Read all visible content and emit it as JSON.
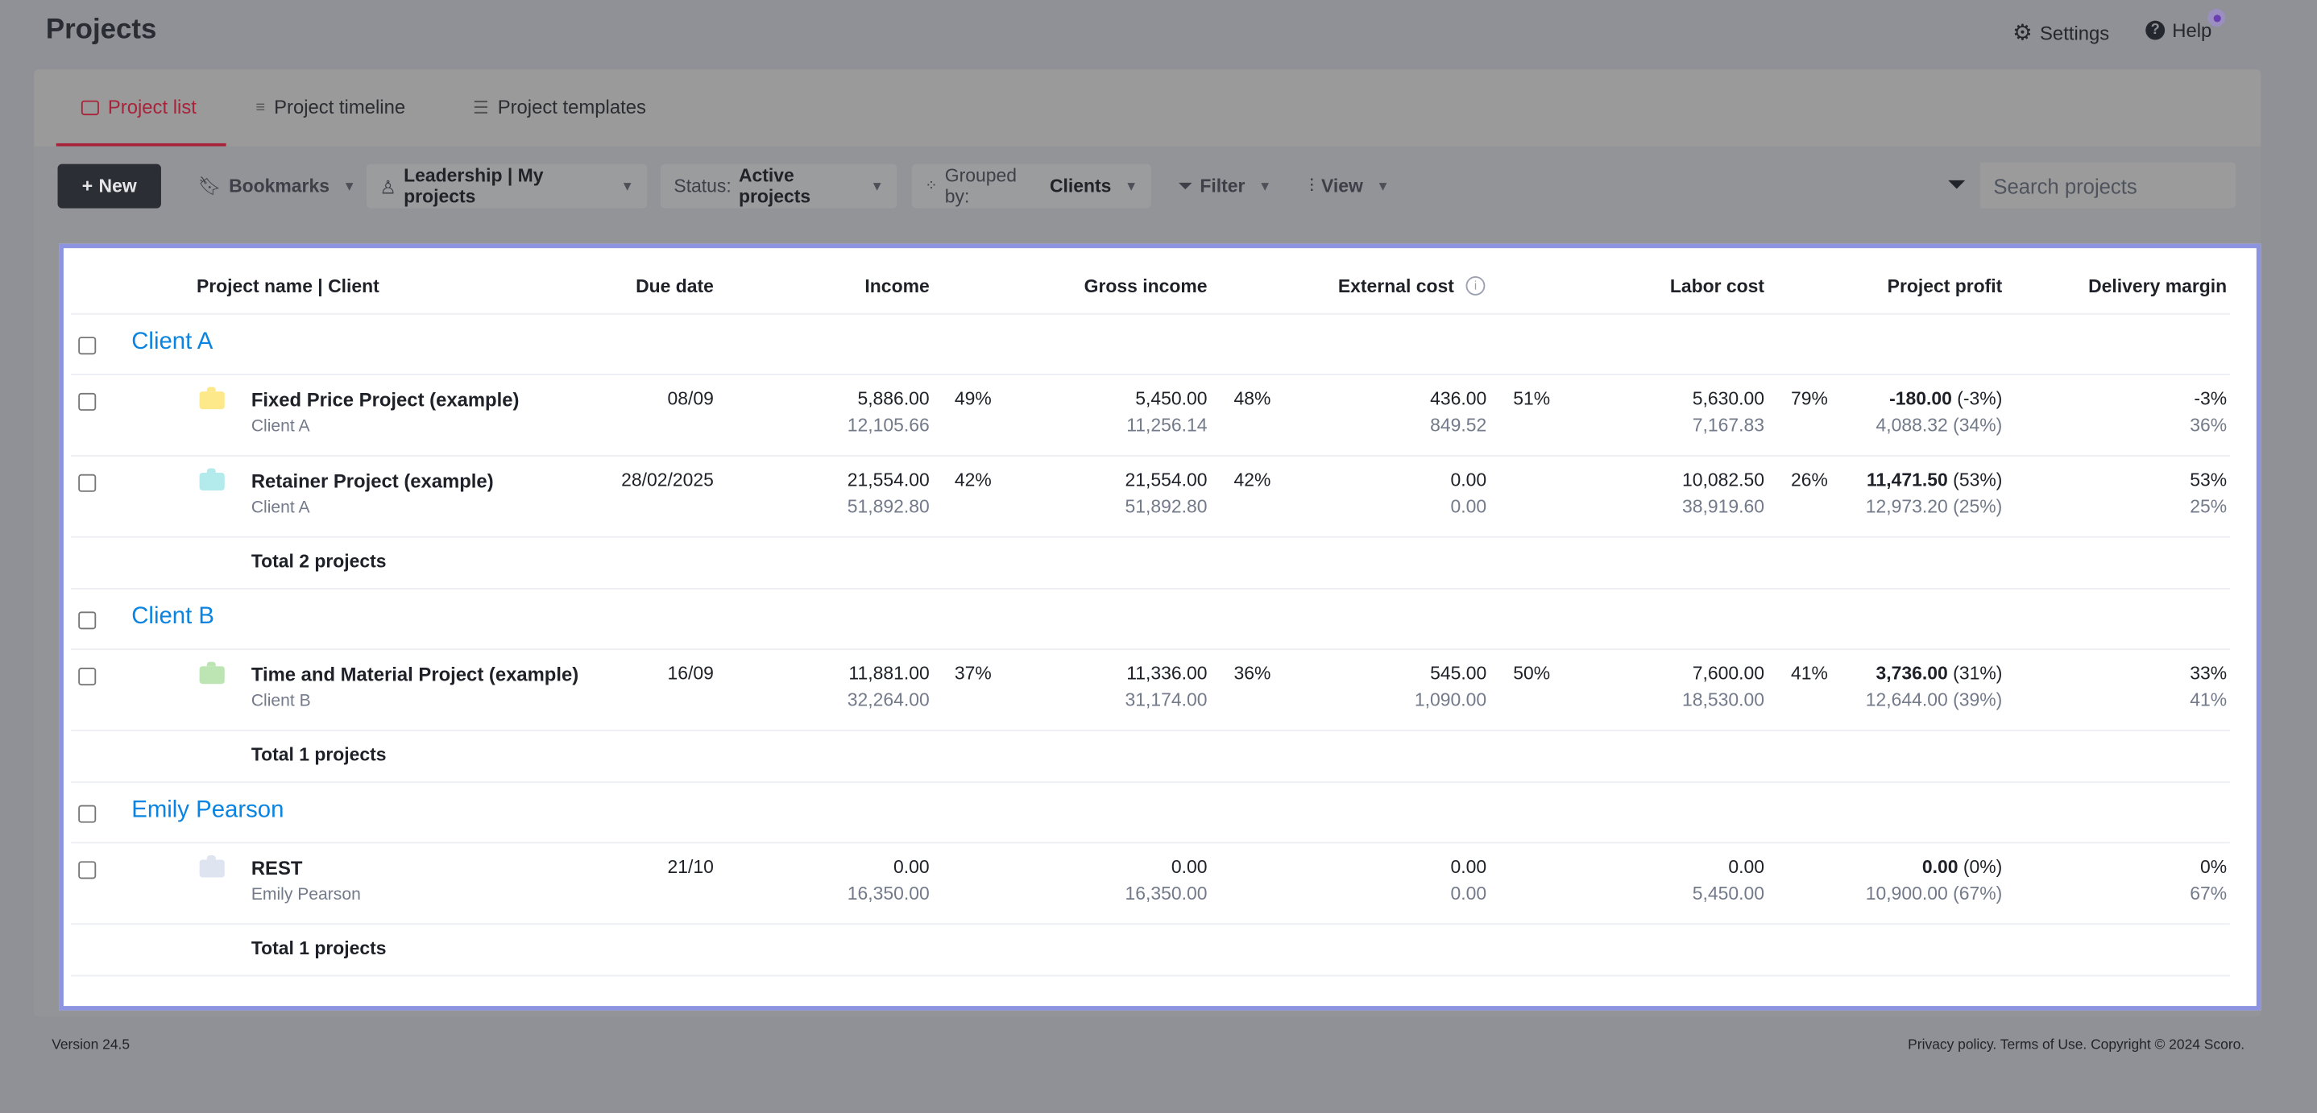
{
  "page": {
    "title": "Projects"
  },
  "header": {
    "settings": "Settings",
    "help": "Help",
    "notification_color": "#6a3fb0"
  },
  "tabs": [
    {
      "label": "Project list",
      "icon": "briefcase-icon",
      "active": true
    },
    {
      "label": "Project timeline",
      "icon": "timeline-icon",
      "active": false
    },
    {
      "label": "Project templates",
      "icon": "list-icon",
      "active": false
    }
  ],
  "toolbar": {
    "new_label": "New",
    "bookmarks": "Bookmarks",
    "view_scope": "Leadership | My projects",
    "status_prefix": "Status:",
    "status_value": "Active projects",
    "grouped_prefix": "Grouped by:",
    "grouped_value": "Clients",
    "filter": "Filter",
    "view": "View",
    "search_placeholder": "Search projects"
  },
  "table": {
    "columns": [
      "Project name | Client",
      "Due date",
      "Income",
      "Gross income",
      "External cost",
      "Labor cost",
      "Project profit",
      "Delivery margin"
    ],
    "groups": [
      {
        "name": "Client A",
        "total": "Total 2 projects",
        "projects": [
          {
            "name": "Fixed Price Project (example)",
            "client": "Client A",
            "color": "#fde98a",
            "due": "08/09",
            "income": "5,886.00",
            "income_pct": "49%",
            "income_sub": "12,105.66",
            "gross": "5,450.00",
            "gross_pct": "48%",
            "gross_sub": "11,256.14",
            "ext": "436.00",
            "ext_pct": "51%",
            "ext_sub": "849.52",
            "labor": "5,630.00",
            "labor_pct": "79%",
            "labor_sub": "7,167.83",
            "profit": "-180.00",
            "profit_pct": "(-3%)",
            "profit_sub": "4,088.32 (34%)",
            "margin": "-3%",
            "margin_sub": "36%"
          },
          {
            "name": "Retainer Project (example)",
            "client": "Client A",
            "color": "#b3ebec",
            "due": "28/02/2025",
            "income": "21,554.00",
            "income_pct": "42%",
            "income_sub": "51,892.80",
            "gross": "21,554.00",
            "gross_pct": "42%",
            "gross_sub": "51,892.80",
            "ext": "0.00",
            "ext_pct": "",
            "ext_sub": "0.00",
            "labor": "10,082.50",
            "labor_pct": "26%",
            "labor_sub": "38,919.60",
            "profit": "11,471.50",
            "profit_pct": "(53%)",
            "profit_sub": "12,973.20 (25%)",
            "margin": "53%",
            "margin_sub": "25%"
          }
        ]
      },
      {
        "name": "Client B",
        "total": "Total 1 projects",
        "projects": [
          {
            "name": "Time and Material Project (example)",
            "client": "Client B",
            "color": "#bde5b4",
            "due": "16/09",
            "income": "11,881.00",
            "income_pct": "37%",
            "income_sub": "32,264.00",
            "gross": "11,336.00",
            "gross_pct": "36%",
            "gross_sub": "31,174.00",
            "ext": "545.00",
            "ext_pct": "50%",
            "ext_sub": "1,090.00",
            "labor": "7,600.00",
            "labor_pct": "41%",
            "labor_sub": "18,530.00",
            "profit": "3,736.00",
            "profit_pct": "(31%)",
            "profit_sub": "12,644.00 (39%)",
            "margin": "33%",
            "margin_sub": "41%"
          }
        ]
      },
      {
        "name": "Emily Pearson",
        "total": "Total 1 projects",
        "projects": [
          {
            "name": "REST",
            "client": "Emily Pearson",
            "color": "#dfe5f0",
            "due": "21/10",
            "income": "0.00",
            "income_pct": "",
            "income_sub": "16,350.00",
            "gross": "0.00",
            "gross_pct": "",
            "gross_sub": "16,350.00",
            "ext": "0.00",
            "ext_pct": "",
            "ext_sub": "0.00",
            "labor": "0.00",
            "labor_pct": "",
            "labor_sub": "5,450.00",
            "profit": "0.00",
            "profit_pct": "(0%)",
            "profit_sub": "10,900.00 (67%)",
            "margin": "0%",
            "margin_sub": "67%"
          }
        ]
      }
    ]
  },
  "footer": {
    "version": "Version 24.5",
    "legal": "Privacy policy. Terms of Use. Copyright © 2024 Scoro."
  }
}
